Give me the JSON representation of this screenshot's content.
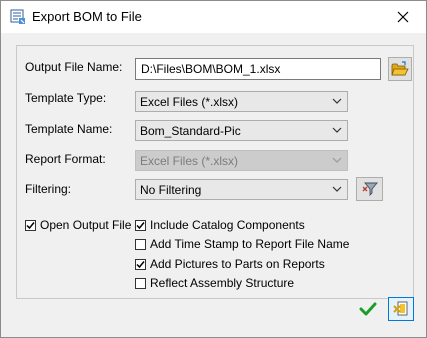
{
  "window": {
    "title": "Export BOM to File",
    "close_glyph": "✕"
  },
  "form": {
    "output_file_name": {
      "label": "Output File Name:",
      "value": "D:\\Files\\BOM\\BOM_1.xlsx"
    },
    "template_type": {
      "label": "Template Type:",
      "value": "Excel Files (*.xlsx)"
    },
    "template_name": {
      "label": "Template Name:",
      "value": "Bom_Standard-Pic"
    },
    "report_format": {
      "label": "Report Format:",
      "value": "Excel Files (*.xlsx)",
      "enabled": false
    },
    "filtering": {
      "label": "Filtering:",
      "value": "No Filtering"
    }
  },
  "options": {
    "open_output_file": {
      "label": "Open Output File",
      "checked": true
    },
    "include_catalog_components": {
      "label": "Include Catalog Components",
      "checked": true
    },
    "add_time_stamp": {
      "label": "Add Time Stamp to Report File Name",
      "checked": false
    },
    "add_pictures": {
      "label": "Add Pictures to Parts on Reports",
      "checked": true
    },
    "reflect_assembly": {
      "label": "Reflect Assembly Structure",
      "checked": false
    }
  },
  "icons": {
    "app": "export-bom-icon",
    "browse": "open-folder-icon",
    "filter": "filter-tool-icon",
    "ok": "checkmark-icon",
    "cancel": "cancel-icon"
  },
  "colors": {
    "ok_green": "#1a9e2a",
    "folder_yellow": "#f2c230",
    "accent_blue": "#0078d7"
  }
}
